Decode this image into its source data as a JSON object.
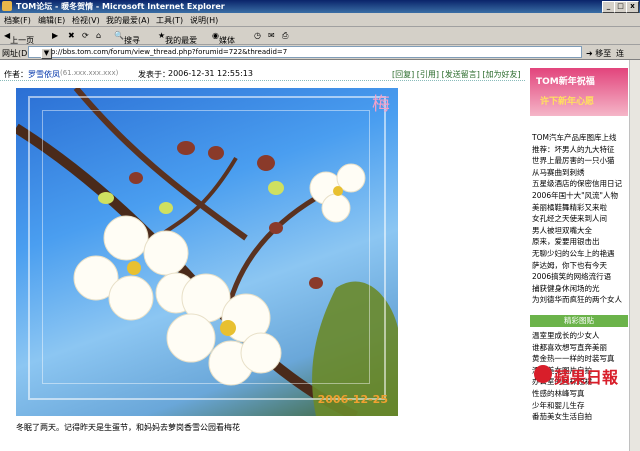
{
  "window": {
    "title": "TOM论坛 - 暖冬贺情 - Microsoft Internet Explorer",
    "min": "_",
    "max": "□",
    "close": "x"
  },
  "menu": [
    "档案(F)",
    "编辑(E)",
    "检视(V)",
    "我的最爱(A)",
    "工具(T)",
    "说明(H)"
  ],
  "toolbar": {
    "back": "上一页",
    "search": "搜寻",
    "favorites": "我的最爱",
    "media": "媒体"
  },
  "address": {
    "label": "网址(D)",
    "url": "http://bbs.tom.com/forum/view_thread.php?forumid=722&threadid=7",
    "go": "移至",
    "links": "连"
  },
  "post": {
    "author_label": "作者：",
    "author_name": "罗雪依凤",
    "ip": "(61.xxx.xxx.xxx)",
    "posted_label": "发表于：",
    "posted_time": "2006-12-31 12:55:13",
    "actions": "[回复] [引用] [发送留言] [加为好友]",
    "photo_watermark": "梅",
    "photo_date": "2006-12-25",
    "caption": "冬眠了两天。记得昨天是生蛋节，和妈妈去萝岗香雪公园看梅花"
  },
  "sidebar": {
    "banner_title": "TOM新年祝福",
    "banner_sub": "许下新年心愿",
    "links": [
      "TOM汽车产品库图库上线",
      "推荐：坏男人的九大特征",
      "世界上最厉害的一只小猫",
      "从马赛曲到刺绣",
      "五星级酒店的保密信用日记",
      "2006年国十大\"风流\"人物",
      "美丽橘鞋舞精彩又来啦",
      "女孔经之天使来到人间",
      "男人被坦双嘴大全",
      "原来，爱要用银击出",
      "无聊少妇的公车上的艳遇",
      "萨达姆，你下也有今天",
      "2006搞笑的网络流行语",
      "捕获健身休闲场的光",
      "为刘德华而疯狂的两个女人"
    ],
    "section_head": "精彩图贴",
    "links2": [
      "温室里成长的少女人",
      "谁都喜欢想写直奔美丽",
      "黄金热一一样的时装写真",
      "漂亮美女图片自拍",
      "办公室的丝袜短裙",
      "性感的林峰写真",
      "少年和婴儿生存",
      "番茄美女生活自拍"
    ],
    "logo": "蘋果日報"
  }
}
